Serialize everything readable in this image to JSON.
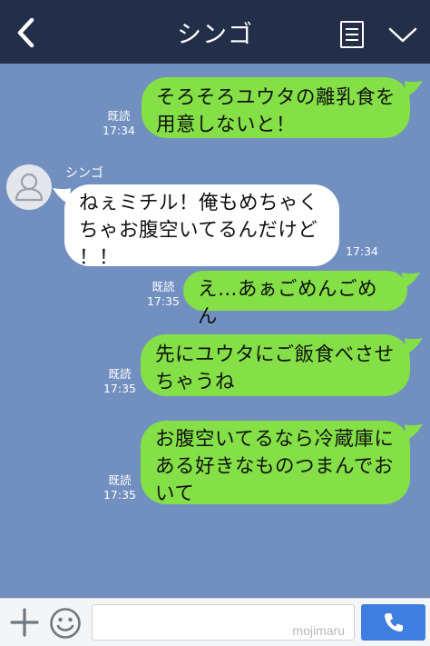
{
  "header": {
    "title": "シンゴ",
    "back_icon": "chevron-left-icon",
    "notes_icon": "notes-icon",
    "menu_icon": "chevron-down-icon"
  },
  "messages": [
    {
      "direction": "outgoing",
      "lines": [
        "そろそろユウタの離乳食を",
        "用意しないと！"
      ],
      "read_label": "既読",
      "time": "17:34"
    },
    {
      "direction": "incoming",
      "sender": "シンゴ",
      "lines": [
        "ねぇミチル！俺もめちゃく",
        "ちゃお腹空いてるんだけど",
        "！！"
      ],
      "time": "17:34"
    },
    {
      "direction": "outgoing",
      "lines": [
        "え…あぁごめんごめん"
      ],
      "read_label": "既読",
      "time": "17:35"
    },
    {
      "direction": "outgoing",
      "lines": [
        "先にユウタにご飯食べさせ",
        "ちゃうね"
      ],
      "read_label": "既読",
      "time": "17:35"
    },
    {
      "direction": "outgoing",
      "lines": [
        "お腹空いてるなら冷蔵庫に",
        "ある好きなものつまんでお",
        "いて"
      ],
      "read_label": "既読",
      "time": "17:35"
    }
  ],
  "footer": {
    "plus_icon": "plus-icon",
    "emoji_icon": "smiley-icon",
    "input_value": "",
    "watermark": "mojimaru",
    "call_icon": "phone-icon"
  },
  "colors": {
    "header_bg": "#232f48",
    "chat_bg": "#7190c0",
    "outgoing_bubble": "#84e046",
    "incoming_bubble": "#ffffff",
    "call_button": "#3f7ee1"
  }
}
